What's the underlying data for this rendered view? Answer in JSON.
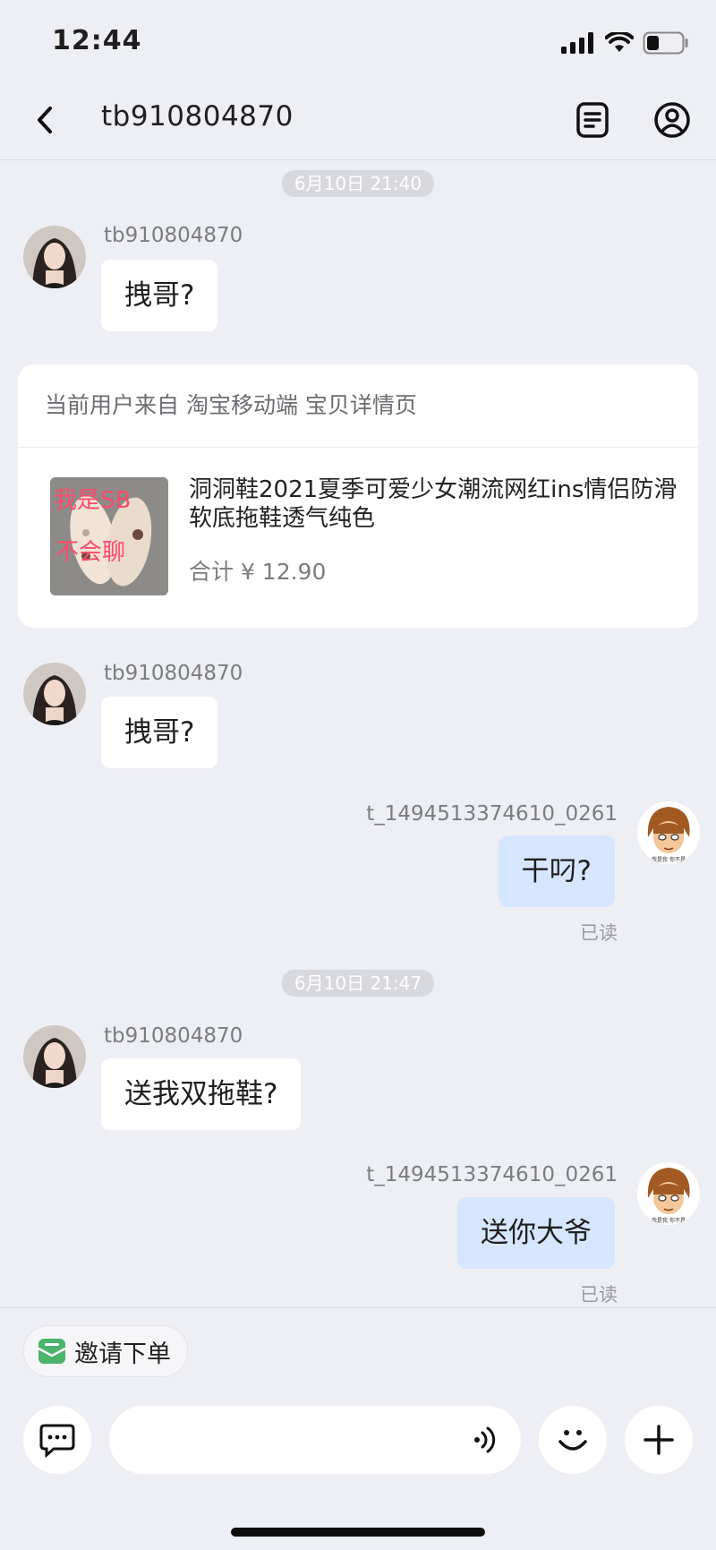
{
  "status_bar": {
    "time": "12:44"
  },
  "header": {
    "title": "tb910804870",
    "back_icon": "chevron-left-icon",
    "list_icon": "document-list-icon",
    "profile_icon": "user-circle-icon"
  },
  "messages": {
    "ts1": "6月10日 21:40",
    "ts2": "6月10日 21:47",
    "m1": {
      "sender": "tb910804870",
      "text": "拽哥?"
    },
    "card": {
      "header": "当前用户来自 淘宝移动端 宝贝详情页",
      "product_title": "洞洞鞋2021夏季可爱少女潮流网红ins情侣防滑软底拖鞋透气纯色",
      "price": "合计 ¥ 12.90",
      "image_overlay_text": "我是SB 不会聊"
    },
    "m2": {
      "sender": "tb910804870",
      "text": "拽哥?"
    },
    "m3": {
      "sender": "t_1494513374610_0261",
      "text": "干叼?",
      "status": "已读"
    },
    "m4": {
      "sender": "tb910804870",
      "text": "送我双拖鞋?"
    },
    "m5": {
      "sender": "t_1494513374610_0261",
      "text": "送你大爷",
      "status": "已读"
    },
    "out_avatar_caption": "我是我 你不是"
  },
  "footer": {
    "invite_label": "邀请下单",
    "input_placeholder": "",
    "icons": [
      "chat-bubble-icon",
      "voice-icon",
      "smiley-icon",
      "plus-icon"
    ]
  },
  "colors": {
    "background": "#eeeff4",
    "incoming_bubble": "#ffffff",
    "outgoing_bubble": "#d7e6ff",
    "accent_green": "#4cb36b"
  }
}
